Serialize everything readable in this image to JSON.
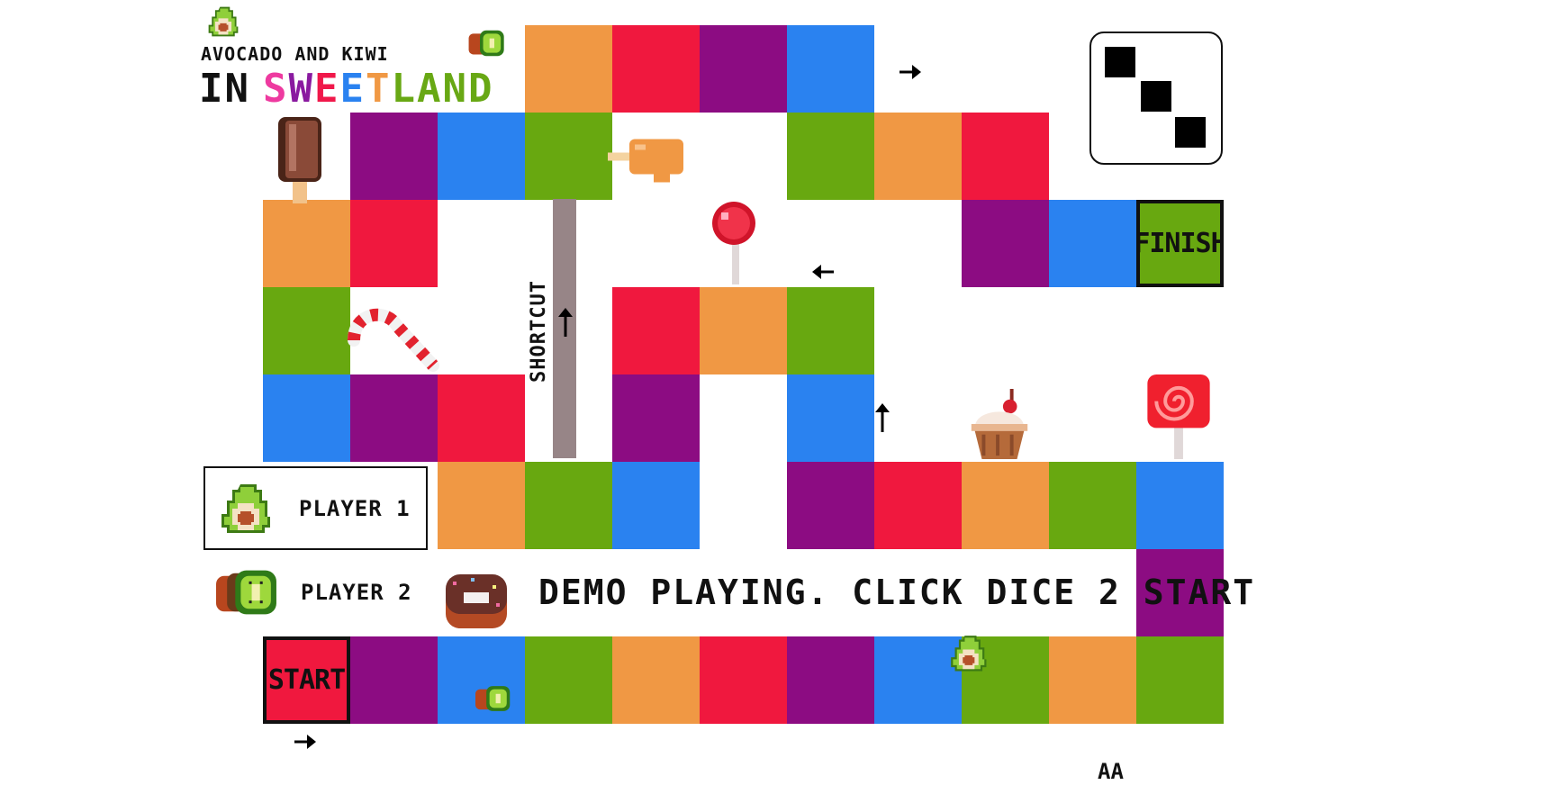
{
  "title": {
    "line1": "AVOCADO AND KIWI",
    "line2_prefix": "IN",
    "line2_letters": [
      {
        "ch": "S",
        "color": "#ee3aa0"
      },
      {
        "ch": "W",
        "color": "#8a1aa0"
      },
      {
        "ch": "E",
        "color": "#f0184a"
      },
      {
        "ch": "E",
        "color": "#2a82f0"
      },
      {
        "ch": "T",
        "color": "#f09844"
      },
      {
        "ch": "L",
        "color": "#68a814"
      },
      {
        "ch": "A",
        "color": "#68a814"
      },
      {
        "ch": "N",
        "color": "#68a814"
      },
      {
        "ch": "D",
        "color": "#68a814"
      }
    ]
  },
  "colors": {
    "orange": "#f09844",
    "red": "#f0183e",
    "purple": "#8c0c82",
    "blue": "#2a82f0",
    "green": "#68a810",
    "shortcut": "#978587"
  },
  "labels": {
    "start": "START",
    "finish": "FINISH",
    "shortcut": "SHORTCUT"
  },
  "players": [
    {
      "label": "PLAYER 1",
      "token": "avocado-icon",
      "active": true
    },
    {
      "label": "PLAYER 2",
      "token": "kiwi-icon",
      "active": false
    }
  ],
  "status": "DEMO PLAYING. CLICK DICE 2 START",
  "dice": {
    "value": 3
  },
  "footer": "AA",
  "sweets": [
    "ice-cream-bar-icon",
    "candy-cane-icon",
    "lollipop-icon",
    "orange-popsicle-icon",
    "cupcake-icon",
    "swirl-lollipop-icon",
    "donut-icon"
  ]
}
